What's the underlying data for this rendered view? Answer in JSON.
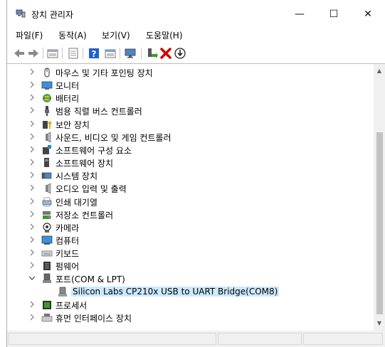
{
  "window": {
    "title": "장치 관리자",
    "controls": {
      "minimize": "—",
      "maximize": "☐",
      "close": "✕"
    }
  },
  "menu": [
    "파일(F)",
    "동작(A)",
    "보기(V)",
    "도움말(H)"
  ],
  "toolbar": {
    "buttons": [
      "back-icon",
      "forward-icon",
      "device-view-icon",
      "properties-icon",
      "help-icon",
      "details-icon",
      "monitor-icon",
      "enable-device-icon",
      "uninstall-icon",
      "update-driver-icon"
    ]
  },
  "tree": [
    {
      "label": "마우스 및 기타 포인팅 장치",
      "icon": "mouse-icon",
      "expanded": false
    },
    {
      "label": "모니터",
      "icon": "monitor-icon",
      "expanded": false
    },
    {
      "label": "배터리",
      "icon": "battery-icon",
      "expanded": false
    },
    {
      "label": "범용 직렬 버스 컨트롤러",
      "icon": "usb-icon",
      "expanded": false
    },
    {
      "label": "보안 장치",
      "icon": "security-key-icon",
      "expanded": false
    },
    {
      "label": "사운드, 비디오 및 게임 컨트롤러",
      "icon": "speaker-icon",
      "expanded": false
    },
    {
      "label": "소프트웨어 구성 요소",
      "icon": "software-component-icon",
      "expanded": false
    },
    {
      "label": "소프트웨어 장치",
      "icon": "software-device-icon",
      "expanded": false
    },
    {
      "label": "시스템 장치",
      "icon": "system-icon",
      "expanded": false
    },
    {
      "label": "오디오 입력 및 출력",
      "icon": "audio-icon",
      "expanded": false
    },
    {
      "label": "인쇄 대기열",
      "icon": "printer-icon",
      "expanded": false
    },
    {
      "label": "저장소 컨트롤러",
      "icon": "storage-icon",
      "expanded": false
    },
    {
      "label": "카메라",
      "icon": "camera-icon",
      "expanded": false
    },
    {
      "label": "컴퓨터",
      "icon": "computer-icon",
      "expanded": false
    },
    {
      "label": "키보드",
      "icon": "keyboard-icon",
      "expanded": false
    },
    {
      "label": "펌웨어",
      "icon": "firmware-icon",
      "expanded": false
    },
    {
      "label": "포트(COM & LPT)",
      "icon": "port-icon",
      "expanded": true
    },
    {
      "label": "Silicon Labs CP210x USB to UART Bridge(COM8)",
      "icon": "port-device-icon",
      "child": true,
      "selected": true
    },
    {
      "label": "프로세서",
      "icon": "processor-icon",
      "expanded": false
    },
    {
      "label": "휴먼 인터페이스 장치",
      "icon": "hid-icon",
      "expanded": false
    }
  ],
  "colors": {
    "selection": "#cce8ff",
    "toolbar_blue": "#1e62c8",
    "uninstall_red": "#d00000",
    "enable_green": "#3a9a2a"
  }
}
